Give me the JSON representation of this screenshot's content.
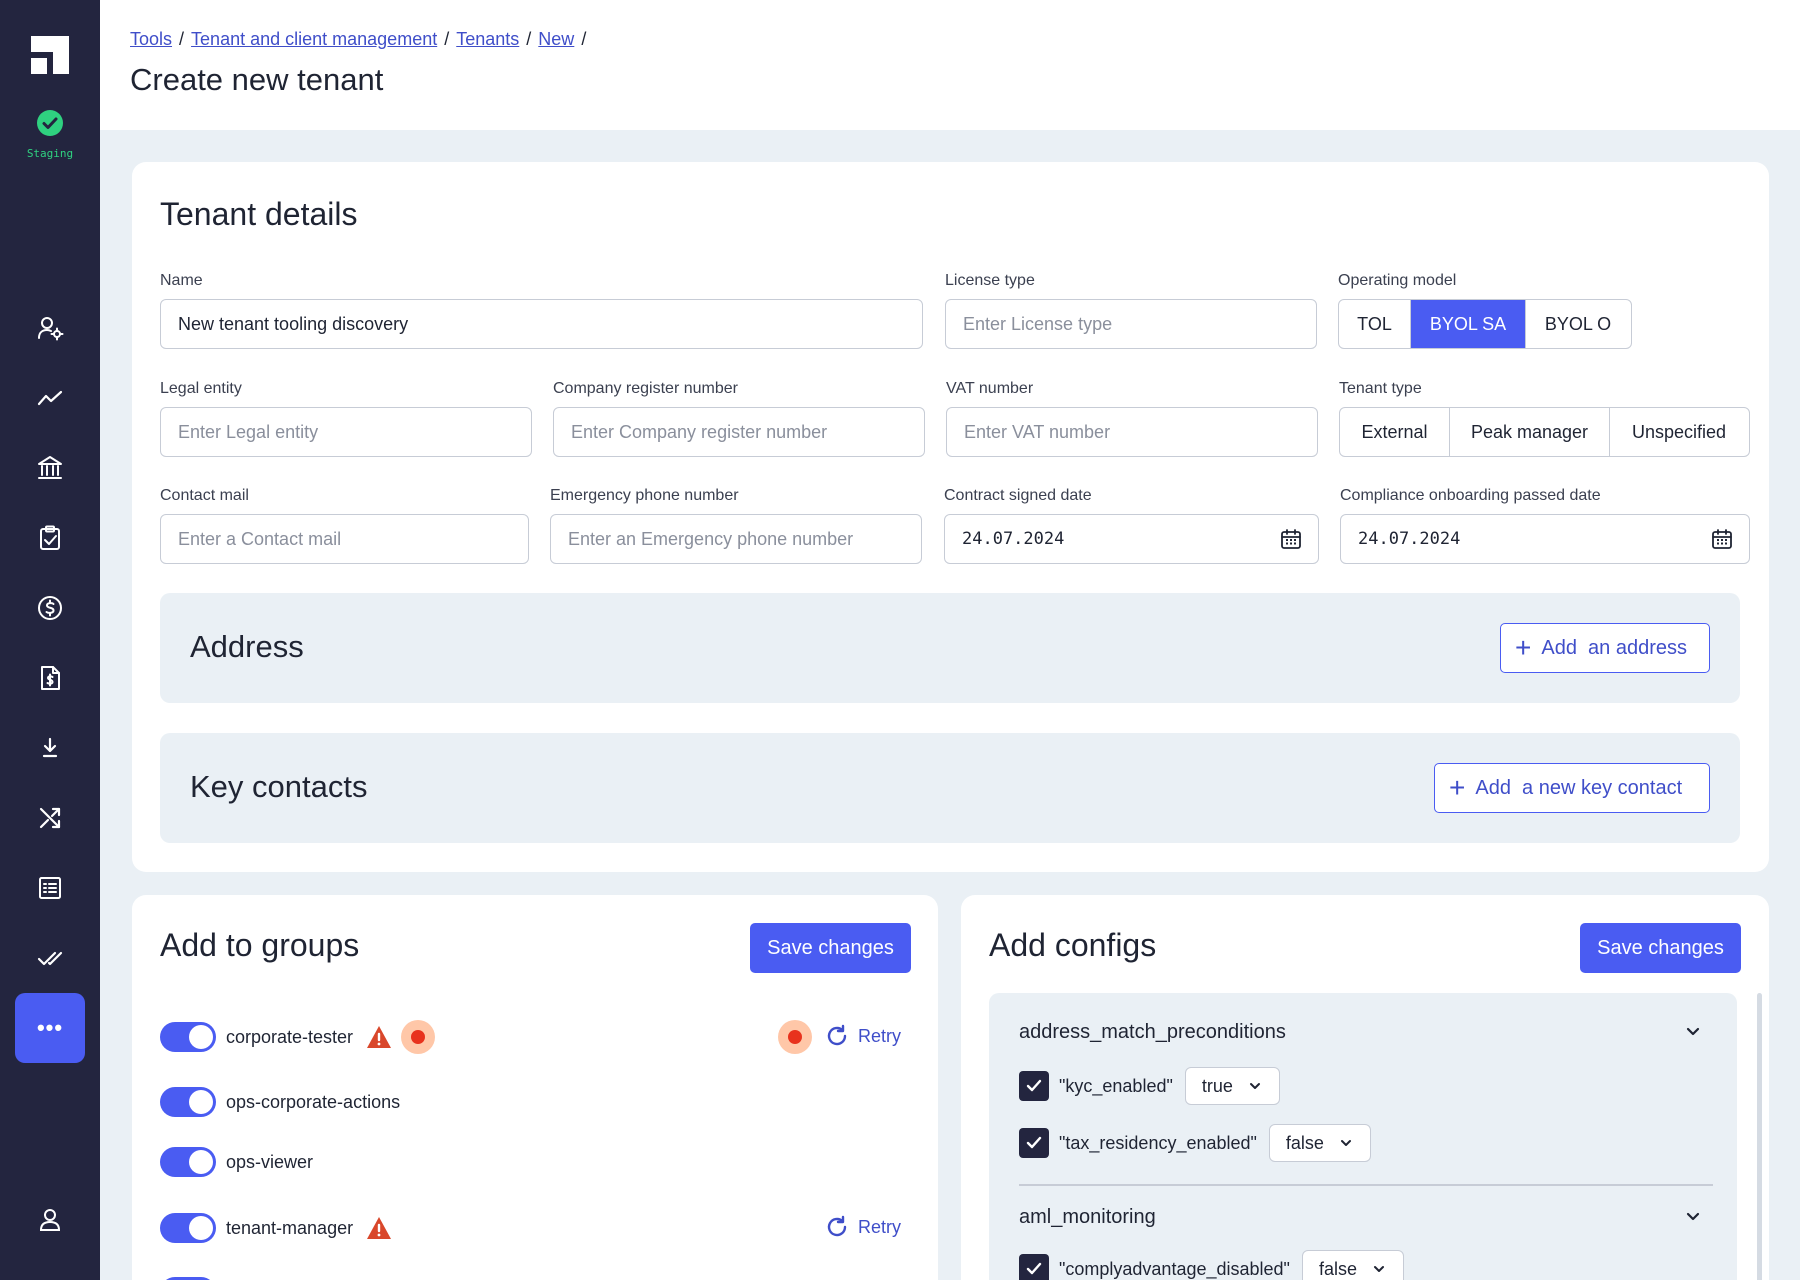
{
  "environment": {
    "label": "Staging"
  },
  "breadcrumb": {
    "items": [
      "Tools",
      "Tenant and client management",
      "Tenants",
      "New"
    ],
    "separator": "/"
  },
  "page_title": "Create new tenant",
  "tenant_details": {
    "title": "Tenant details",
    "name": {
      "label": "Name",
      "value": "New tenant tooling discovery"
    },
    "license_type": {
      "label": "License type",
      "placeholder": "Enter License type"
    },
    "operating_model": {
      "label": "Operating model",
      "options": [
        "TOL",
        "BYOL SA",
        "BYOL O"
      ],
      "selected": "BYOL SA"
    },
    "legal_entity": {
      "label": "Legal entity",
      "placeholder": "Enter Legal entity"
    },
    "company_register_number": {
      "label": "Company register number",
      "placeholder": "Enter Company register number"
    },
    "vat_number": {
      "label": "VAT number",
      "placeholder": "Enter VAT number"
    },
    "tenant_type": {
      "label": "Tenant type",
      "options": [
        "External",
        "Peak manager",
        "Unspecified"
      ]
    },
    "contact_mail": {
      "label": "Contact mail",
      "placeholder": "Enter a Contact mail"
    },
    "emergency_phone": {
      "label": "Emergency phone number",
      "placeholder": "Enter an Emergency phone number"
    },
    "contract_signed_date": {
      "label": "Contract signed date",
      "value": "24.07.2024"
    },
    "compliance_onboarding_date": {
      "label": "Compliance onboarding passed date",
      "value": "24.07.2024"
    },
    "address": {
      "title": "Address",
      "button_plus": "+",
      "button_label": "Add  an address"
    },
    "key_contacts": {
      "title": "Key contacts",
      "button_plus": "+",
      "button_label": "Add  a new key contact"
    }
  },
  "groups": {
    "title": "Add to groups",
    "save_label": "Save changes",
    "retry_label": "Retry",
    "items": [
      {
        "name": "corporate-tester",
        "enabled": true,
        "warning": true,
        "error": true,
        "retry": true
      },
      {
        "name": "ops-corporate-actions",
        "enabled": true,
        "warning": false,
        "error": false,
        "retry": false
      },
      {
        "name": "ops-viewer",
        "enabled": true,
        "warning": false,
        "error": false,
        "retry": false
      },
      {
        "name": "tenant-manager",
        "enabled": true,
        "warning": true,
        "error": false,
        "retry": true
      }
    ]
  },
  "configs": {
    "title": "Add configs",
    "save_label": "Save changes",
    "groups": [
      {
        "name": "address_match_preconditions",
        "entries": [
          {
            "key": "\"kyc_enabled\"",
            "value": "true",
            "checked": true
          },
          {
            "key": "\"tax_residency_enabled\"",
            "value": "false",
            "checked": true
          }
        ]
      },
      {
        "name": "aml_monitoring",
        "entries": [
          {
            "key": "\"complyadvantage_disabled\"",
            "value": "false",
            "checked": true
          }
        ]
      }
    ]
  },
  "colors": {
    "sidebar": "#23253f",
    "accent": "#4a5cf2",
    "staging": "#2fd180",
    "warning": "#d9472b",
    "error": "#e8321d",
    "background": "#eaf0f5"
  }
}
